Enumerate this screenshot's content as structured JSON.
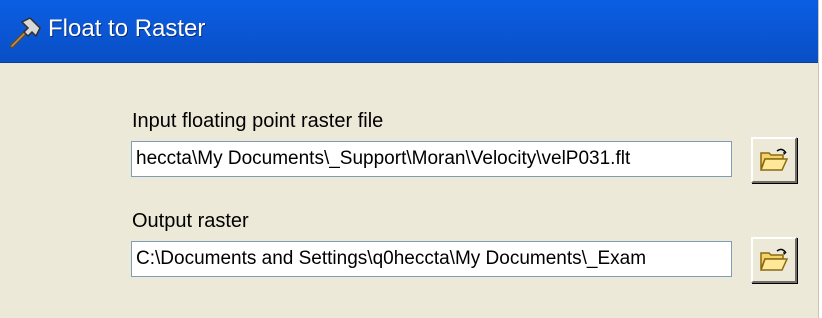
{
  "window": {
    "title": "Float to Raster",
    "icon": "hammer-icon"
  },
  "input_file": {
    "label": "Input floating point raster file",
    "value": "heccta\\My Documents\\_Support\\Moran\\Velocity\\velP031.flt",
    "browse_icon": "open-folder-icon"
  },
  "output_raster": {
    "label": "Output raster",
    "value": "C:\\Documents and Settings\\q0heccta\\My Documents\\_Exam",
    "browse_icon": "open-folder-icon"
  },
  "colors": {
    "titlebar": "#0a5fe3",
    "dialog_bg": "#ece9d8",
    "field_border": "#7f9db9"
  }
}
